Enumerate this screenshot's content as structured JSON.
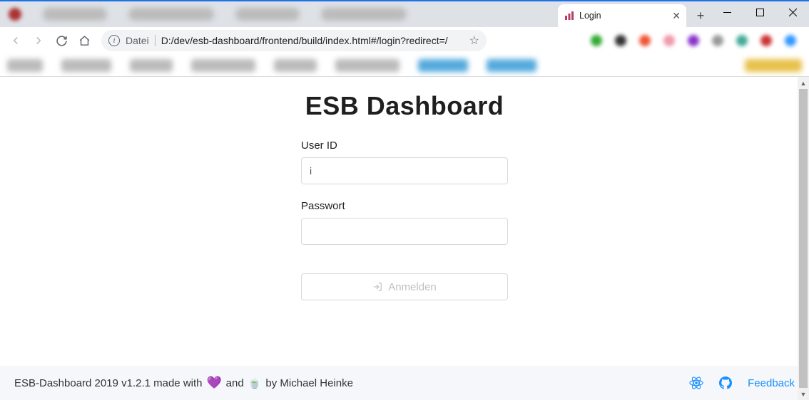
{
  "browser": {
    "tab_title": "Login",
    "url_prefix": "Datei",
    "url": "D:/dev/esb-dashboard/frontend/build/index.html#/login?redirect=/"
  },
  "page": {
    "title": "ESB Dashboard",
    "user_label": "User ID",
    "user_value": "i",
    "password_label": "Passwort",
    "password_value": "",
    "login_button": "Anmelden"
  },
  "footer": {
    "text_a": "ESB-Dashboard 2019 v1.2.1 made with",
    "text_b": "and",
    "text_c": "by Michael Heinke",
    "feedback": "Feedback"
  }
}
